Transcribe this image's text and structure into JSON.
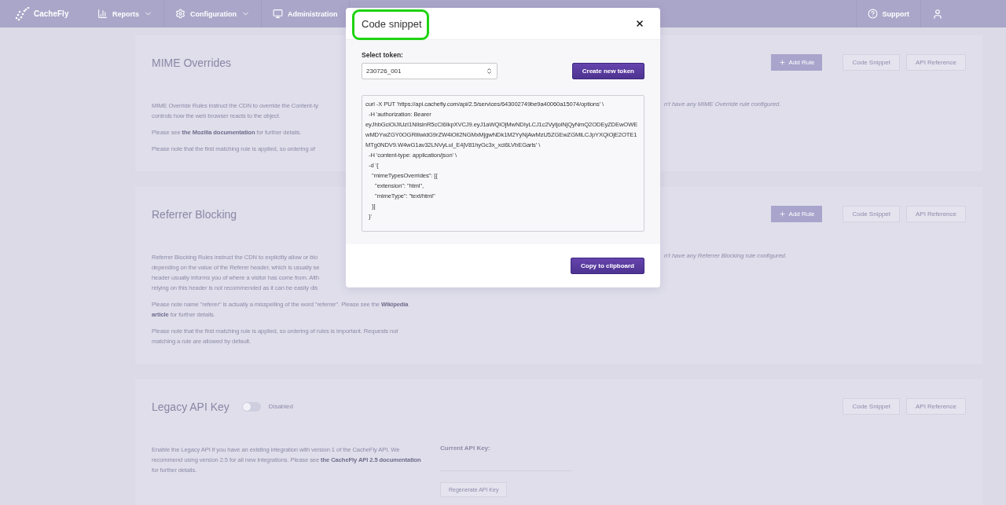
{
  "nav": {
    "logo": "CacheFly",
    "items": [
      {
        "label": "Reports",
        "dropdown": true
      },
      {
        "label": "Configuration",
        "dropdown": true
      },
      {
        "label": "Administration",
        "dropdown": false
      }
    ],
    "support": "Support"
  },
  "sections": [
    {
      "title": "MIME Overrides",
      "buttons": [
        {
          "label": "Add Rule",
          "kind": "add"
        },
        {
          "label": "Code Snippet",
          "kind": "plain"
        },
        {
          "label": "API Reference",
          "kind": "plain"
        }
      ],
      "paragraphs": [
        {
          "lines": [
            "MIME Override Rules instruct the CDN to override the Content-ty",
            "controls how the web browser reacts to the object."
          ]
        },
        {
          "lines": [
            "Please see **the Mozilla documentation** for further details."
          ]
        },
        {
          "lines": [
            "Please note that the first matching rule is applied, so ordering of"
          ]
        }
      ],
      "empty_message": "n't have any MIME Override rule configured."
    },
    {
      "title": "Referrer Blocking",
      "buttons": [
        {
          "label": "Add Rule",
          "kind": "add"
        },
        {
          "label": "Code Snippet",
          "kind": "plain"
        },
        {
          "label": "API Reference",
          "kind": "plain"
        }
      ],
      "paragraphs": [
        {
          "lines": [
            "Referrer Blocking Rules instruct the CDN to explicitly allow or blo",
            "depending on the value of the Referer header, which is usually se",
            "header usually informs you of where a visitor has come from. Alth",
            "relying on this header is not recommended as it can be easily dis"
          ]
        },
        {
          "text": "Please note name \"referer\" is actually a misspelling of the word \"referrer\". Please see the **Wikipedia article** for further details."
        },
        {
          "text": "Please note that the first matching rule is applied, so ordering of rules is important. Requests not matching a rule are allowed by default."
        }
      ],
      "empty_message": "n't have any Referrer Blocking rule configured."
    },
    {
      "title": "Legacy API Key",
      "toggle": {
        "on": false,
        "label": "Disabled"
      },
      "buttons": [
        {
          "label": "Code Snippet",
          "kind": "plain"
        },
        {
          "label": "API Reference",
          "kind": "plain"
        }
      ],
      "paragraphs": [
        {
          "text": "Enable the Legacy API if you have an existing integration with version 1 of the CacheFly API. We recommend using version 2.5 for all new integrations. Please see **the CacheFly API 2.5 documentation** for further details."
        }
      ],
      "api_key": {
        "label": "Current API Key:",
        "button": "Regenerate API Key"
      }
    }
  ],
  "modal": {
    "title": "Code snippet",
    "title_highlighted": true,
    "token_label": "Select token:",
    "token_value": "230726_001",
    "create_button": "Create new token",
    "code": "curl -X PUT 'https://api.cachefly.com/api/2.5/services/643002749be9a40060a15074/options' \\\n  -H 'authorization: Bearer eyJhbGciOiJIUzI1NiIsInR5cCI6IkpXVCJ9.eyJ1aWQiOjMwNDIyLCJ1c2VyIjoiNjQyNmQ2ODEyZDEwOWEwMDYwZGY0OGRiIiwidG9rZW4iOiI2NGMxMjgwNDk1M2YyNjAwMzU5ZGEwZGMiLCJpYXQiOjE2OTE1MTg0NDV9.W4wG1av32LNVyLul_E4jV81hyGc3x_xci6LVbEGarls' \\\n  -H 'content-type: application/json' \\\n  -d '{\n    \"mimeTypesOverrides\": [{\n      \"extension\": \"html\",\n      \"mimeType\": \"text/html\"\n    }]\n  }'",
    "copy_button": "Copy to clipboard"
  }
}
